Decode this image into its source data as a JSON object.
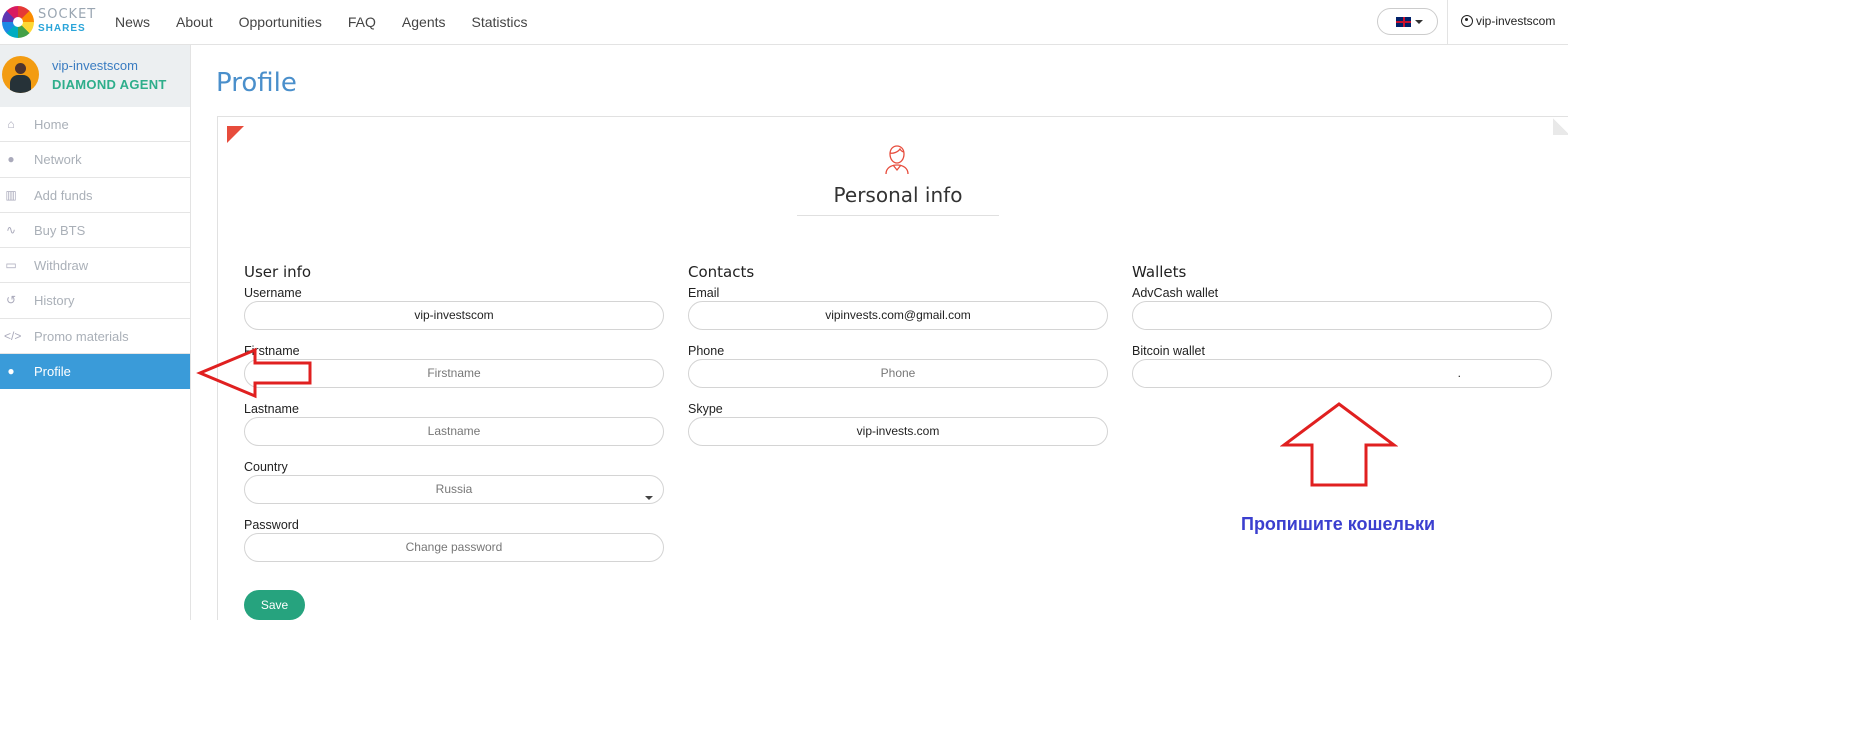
{
  "logo": {
    "line1": "SOCKET",
    "line2": "SHARES"
  },
  "nav": [
    {
      "label": "News"
    },
    {
      "label": "About"
    },
    {
      "label": "Opportunities"
    },
    {
      "label": "FAQ"
    },
    {
      "label": "Agents"
    },
    {
      "label": "Statistics"
    }
  ],
  "header": {
    "language": "en-GB",
    "account_label": "vip-investscom"
  },
  "agent": {
    "name": "vip-investscom",
    "rank": "DIAMOND AGENT"
  },
  "sidebar": {
    "items": [
      {
        "label": "Home",
        "icon": "home-icon"
      },
      {
        "label": "Network",
        "icon": "users-icon"
      },
      {
        "label": "Add funds",
        "icon": "bank-icon"
      },
      {
        "label": "Buy BTS",
        "icon": "chart-icon"
      },
      {
        "label": "Withdraw",
        "icon": "credit-card-icon"
      },
      {
        "label": "History",
        "icon": "history-icon"
      },
      {
        "label": "Promo materials",
        "icon": "code-icon"
      },
      {
        "label": "Profile",
        "icon": "user-icon",
        "active": true
      }
    ]
  },
  "page": {
    "title": "Profile"
  },
  "panel": {
    "title": "Personal info"
  },
  "user_info": {
    "heading": "User info",
    "username": {
      "label": "Username",
      "value": "vip-investscom"
    },
    "firstname": {
      "label": "Firstname",
      "placeholder": "Firstname"
    },
    "lastname": {
      "label": "Lastname",
      "placeholder": "Lastname"
    },
    "country": {
      "label": "Country",
      "value": "Russia"
    },
    "password": {
      "label": "Password",
      "placeholder": "Change password"
    },
    "save_label": "Save"
  },
  "contacts": {
    "heading": "Contacts",
    "email": {
      "label": "Email",
      "value": "vipinvests.com@gmail.com"
    },
    "phone": {
      "label": "Phone",
      "placeholder": "Phone"
    },
    "skype": {
      "label": "Skype",
      "value": "vip-invests.com"
    }
  },
  "wallets": {
    "heading": "Wallets",
    "advcash": {
      "label": "AdvCash wallet",
      "value": ""
    },
    "bitcoin": {
      "label": "Bitcoin wallet",
      "value": "."
    }
  },
  "annotation": {
    "note": "Пропишите кошельки",
    "color": "#3b3fcf",
    "arrow_color": "#e02020"
  }
}
